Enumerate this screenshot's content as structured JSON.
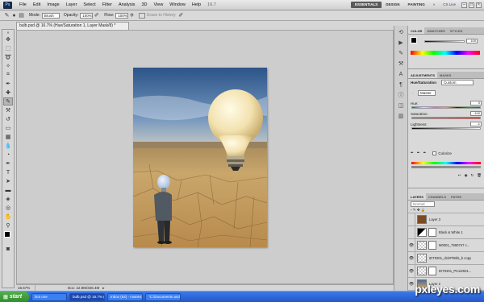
{
  "app": {
    "logo": "Ps"
  },
  "menu": [
    "File",
    "Edit",
    "Image",
    "Layer",
    "Select",
    "Filter",
    "Analysis",
    "3D",
    "View",
    "Window",
    "Help"
  ],
  "zoom_menu": "16.7",
  "workspaces": [
    "ESSENTIALS",
    "DESIGN",
    "PAINTING"
  ],
  "cs_live": "CS Live",
  "options": {
    "mode_label": "Mode:",
    "mode_value": "Brush",
    "opacity_label": "Opacity:",
    "opacity_value": "100%",
    "flow_label": "Flow:",
    "flow_value": "100%",
    "erase_history": "Erase to History"
  },
  "document": {
    "tab_title": "bulb.psd @ 16.7% (Hue/Saturation 1, Layer Mask/8) *",
    "zoom": "16.67%",
    "doc_size": "Doc: 22.9M/346.4M"
  },
  "color_panel": {
    "tabs": [
      "COLOR",
      "SWATCHES",
      "STYLES"
    ],
    "value": "100"
  },
  "adjustments_panel": {
    "tabs": [
      "ADJUSTMENTS",
      "MASKS"
    ],
    "type_label": "Hue/Saturation",
    "preset": "Custom",
    "channel": "Master",
    "hue_label": "Hue:",
    "hue_value": "0",
    "saturation_label": "Saturation:",
    "saturation_value": "-100",
    "lightness_label": "Lightness:",
    "lightness_value": "-1",
    "colorize_label": "Colorize"
  },
  "layers_panel": {
    "tabs": [
      "LAYERS",
      "CHANNELS",
      "PATHS"
    ],
    "blend_mode": "Normal",
    "layers": [
      {
        "name": "Layer 3"
      },
      {
        "name": "Black & White 1"
      },
      {
        "name": "M0001_7590747 c..."
      },
      {
        "name": "IDT0201_d1lzPhBfa_b copy"
      },
      {
        "name": "IDT0201_PCxiZ931..."
      },
      {
        "name": "Layer 2"
      }
    ]
  },
  "taskbar": {
    "start": "start",
    "tasks": [
      "Dot one",
      "bulb.psd @ 16.7% (H...",
      "Inbox (64) - nvanHoo...",
      "\"C:\\Documents and S..."
    ]
  },
  "watermark": "pxleyes.com"
}
